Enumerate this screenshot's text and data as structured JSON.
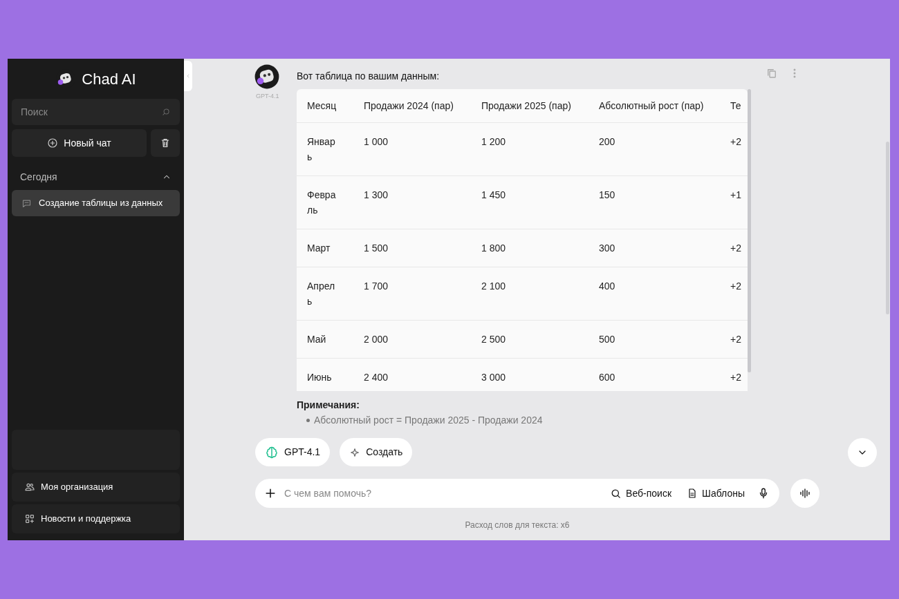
{
  "sidebar": {
    "app_name": "Chad AI",
    "search": {
      "placeholder": "Поиск"
    },
    "new_chat": "Новый чат",
    "section": {
      "title": "Сегодня",
      "expanded": true
    },
    "chats": [
      {
        "label": "Создание таблицы из данных",
        "selected": true
      }
    ],
    "bottom_items": [
      {
        "label": "Моя организация",
        "kind": "org"
      },
      {
        "label": "Новости и поддержка",
        "kind": "news"
      }
    ]
  },
  "message": {
    "model": "GPT-4.1",
    "intro": "Вот таблица по вашим данным:",
    "table": {
      "columns": [
        "Месяц",
        "Продажи 2024 (пар)",
        "Продажи 2025 (пар)",
        "Абсолютный рост (пар)",
        "Те"
      ],
      "rows": [
        [
          "Январь",
          "1 000",
          "1 200",
          "200",
          "+2"
        ],
        [
          "Февраль",
          "1 300",
          "1 450",
          "150",
          "+1"
        ],
        [
          "Март",
          "1 500",
          "1 800",
          "300",
          "+2"
        ],
        [
          "Апрель",
          "1 700",
          "2 100",
          "400",
          "+2"
        ],
        [
          "Май",
          "2 000",
          "2 500",
          "500",
          "+2"
        ],
        [
          "Июнь",
          "2 400",
          "3 000",
          "600",
          "+2"
        ]
      ]
    },
    "notes_title": "Примечания:",
    "notes": [
      "Абсолютный рост = Продажи 2025 - Продажи 2024"
    ]
  },
  "chips": [
    {
      "label": "GPT-4.1",
      "kind": "model"
    },
    {
      "label": "Создать",
      "kind": "create"
    }
  ],
  "composer": {
    "placeholder": "С чем вам помочь?",
    "tools": [
      {
        "label": "Веб-поиск",
        "kind": "search"
      },
      {
        "label": "Шаблоны",
        "kind": "templates"
      }
    ]
  },
  "footer": "Расход слов для текста: x6"
}
